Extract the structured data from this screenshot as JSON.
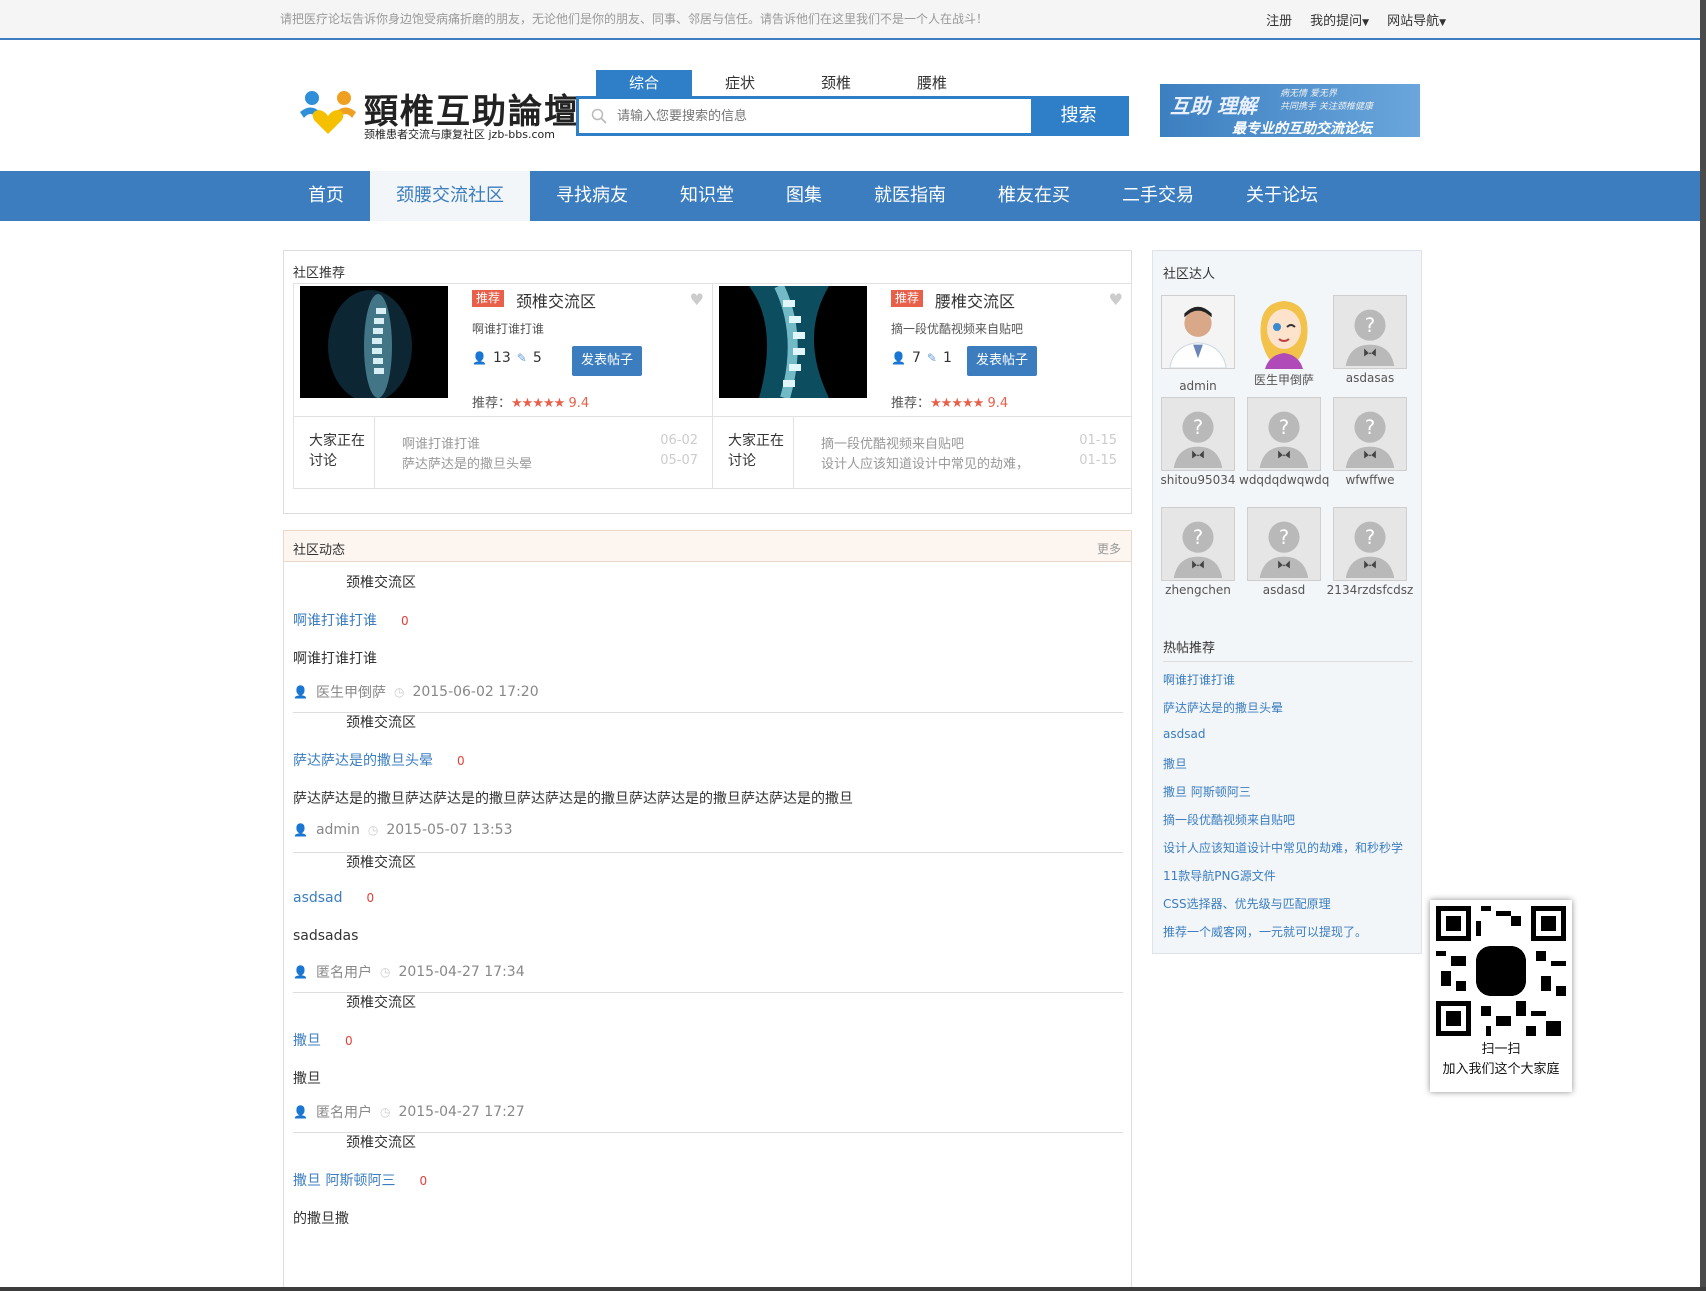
{
  "topbar": {
    "notice": "请把医疗论坛告诉你身边饱受病痛折磨的朋友，无论他们是你的朋友、同事、邻居与信任。请告诉他们在这里我们不是一个人在战斗！",
    "register": "注册",
    "my_questions": "我的提问",
    "site_nav": "网站导航"
  },
  "logo": {
    "title": "頸椎互助論壇",
    "subtitle": "颈椎患者交流与康复社区 jzb-bbs.com"
  },
  "search": {
    "tabs": [
      "综合",
      "症状",
      "颈椎",
      "腰椎"
    ],
    "placeholder": "请输入您要搜索的信息",
    "button": "搜索"
  },
  "banner": {
    "line1": "互助 理解",
    "line2a": "病无情 爱无界",
    "line2b": "共同携手 关注颈椎健康",
    "line3": "最专业的互助交流论坛"
  },
  "nav": {
    "items": [
      "首页",
      "颈腰交流社区",
      "寻找病友",
      "知识堂",
      "图集",
      "就医指南",
      "椎友在买",
      "二手交易",
      "关于论坛"
    ]
  },
  "recommend": {
    "title": "社区推荐",
    "communities": [
      {
        "tag": "推荐",
        "name": "颈椎交流区",
        "desc": "啊谁打谁打谁",
        "members": "13",
        "posts": "5",
        "post_button": "发表帖子",
        "rating_label": "推荐：",
        "stars": "★★★★★",
        "score": "9.4",
        "discuss_label": "大家正在讨论",
        "discussions": [
          {
            "title": "啊谁打谁打谁",
            "date": "06-02"
          },
          {
            "title": "萨达萨达是的撒旦头晕",
            "date": "05-07"
          }
        ]
      },
      {
        "tag": "推荐",
        "name": "腰椎交流区",
        "desc": "摘一段优酷视频来自贴吧",
        "members": "7",
        "posts": "1",
        "post_button": "发表帖子",
        "rating_label": "推荐：",
        "stars": "★★★★★",
        "score": "9.4",
        "discuss_label": "大家正在讨论",
        "discussions": [
          {
            "title": "摘一段优酷视频来自贴吧",
            "date": "01-15"
          },
          {
            "title": "设计人应该知道设计中常见的劫难，",
            "date": "01-15"
          }
        ]
      }
    ]
  },
  "feed": {
    "title": "社区动态",
    "more": "更多",
    "items": [
      {
        "category": "颈椎交流区",
        "title": "啊谁打谁打谁",
        "count": "0",
        "body": "啊谁打谁打谁",
        "user": "医生甲倒萨",
        "time": "2015-06-02 17:20"
      },
      {
        "category": "颈椎交流区",
        "title": "萨达萨达是的撒旦头晕",
        "count": "0",
        "body": "萨达萨达是的撒旦萨达萨达是的撒旦萨达萨达是的撒旦萨达萨达是的撒旦萨达萨达是的撒旦",
        "user": "admin",
        "time": "2015-05-07 13:53"
      },
      {
        "category": "颈椎交流区",
        "title": "asdsad",
        "count": "0",
        "body": "sadsadas",
        "user": "匿名用户",
        "time": "2015-04-27 17:34"
      },
      {
        "category": "颈椎交流区",
        "title": "撒旦",
        "count": "0",
        "body": "撒旦",
        "user": "匿名用户",
        "time": "2015-04-27 17:27"
      },
      {
        "category": "颈椎交流区",
        "title": "撒旦 阿斯顿阿三",
        "count": "0",
        "body": "的撒旦撒",
        "user": "",
        "time": ""
      }
    ]
  },
  "sidebar": {
    "experts_title": "社区达人",
    "experts": [
      "admin",
      "医生甲倒萨",
      "asdasas",
      "shitou95034",
      "wdqdqdwqwdq",
      "wfwffwe",
      "zhengchen",
      "asdasd",
      "2134rzdsfcdsz"
    ],
    "hot_title": "热帖推荐",
    "hot": [
      "啊谁打谁打谁",
      "萨达萨达是的撒旦头晕",
      "asdsad",
      "撒旦",
      "撒旦 阿斯顿阿三",
      "摘一段优酷视频来自贴吧",
      "设计人应该知道设计中常见的劫难，和秒秒学",
      "11款导航PNG源文件",
      "CSS选择器、优先级与匹配原理",
      "推荐一个威客网，一元就可以提现了。"
    ]
  },
  "qr": {
    "line1": "扫一扫",
    "line2": "加入我们这个大家庭"
  },
  "colors": {
    "accent": "#3b7dbf",
    "tag": "#e8604a"
  }
}
